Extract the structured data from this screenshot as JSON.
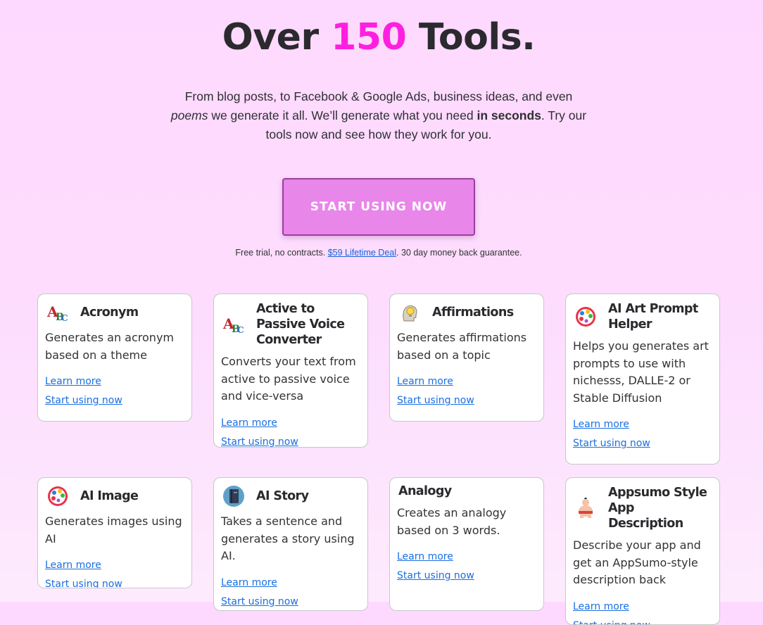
{
  "hero": {
    "title_prefix": "Over ",
    "title_number": "150",
    "title_suffix": " Tools.",
    "description_part1": "From blog posts, to Facebook & Google Ads, business ideas, and even ",
    "description_em": "poems",
    "description_part2": " we generate it all. We’ll generate what you need ",
    "description_bold": "in seconds",
    "description_part3": ". Try our tools now and see how they work for you.",
    "cta_label": "START USING NOW",
    "fineprint_before": "Free trial, no contracts. ",
    "fineprint_link": "$59 Lifetime Deal",
    "fineprint_after": ". 30 day money back guarantee."
  },
  "colors": {
    "accent": "#ff1fe0",
    "cta_background": "#e886e9",
    "cta_border": "#9b3f9f",
    "link": "#1a6fe0"
  },
  "tools": [
    {
      "name": "Acronym",
      "icon": "abc-blocks-icon",
      "description": "Generates an acronym based on a theme",
      "learn_more": "Learn more",
      "start": "Start using now"
    },
    {
      "name": "Active to Passive Voice Converter",
      "icon": "abc-blocks-icon",
      "description": "Converts your text from active to passive voice and vice-versa",
      "learn_more": "Learn more",
      "start": "Start using now"
    },
    {
      "name": "Affirmations",
      "icon": "lightbulb-head-icon",
      "description": "Generates affirmations based on a topic",
      "learn_more": "Learn more",
      "start": "Start using now"
    },
    {
      "name": "AI Art Prompt Helper",
      "icon": "palette-icon",
      "description": "Helps you generates art prompts to use with nichesss, DALLE-2 or Stable Diffusion",
      "learn_more": "Learn more",
      "start": "Start using now"
    },
    {
      "name": "AI Image",
      "icon": "palette-icon",
      "description": "Generates images using AI",
      "learn_more": "Learn more",
      "start": "Start using now"
    },
    {
      "name": "AI Story",
      "icon": "notebook-icon",
      "description": "Takes a sentence and generates a story using AI.",
      "learn_more": "Learn more",
      "start": "Start using now"
    },
    {
      "name": "Analogy",
      "icon": "",
      "description": "Creates an analogy based on 3 words.",
      "learn_more": "Learn more",
      "start": "Start using now"
    },
    {
      "name": "Appsumo Style App Description",
      "icon": "sumo-wrestler-icon",
      "description": "Describe your app and get an AppSumo-style description back",
      "learn_more": "Learn more",
      "start": "Start using now"
    }
  ]
}
